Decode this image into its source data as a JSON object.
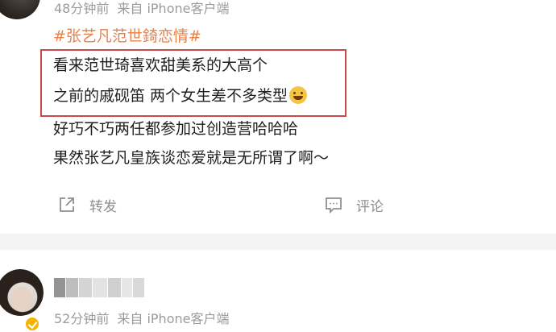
{
  "post1": {
    "time": "48分钟前",
    "source": "来自 iPhone客户端",
    "hashtag": "#张艺凡范世錡恋情#",
    "lines": [
      "看来范世琦喜欢甜美系的大高个",
      "之前的戚砚笛 两个女生差不多类型",
      "好巧不巧两任都参加过创造营哈哈哈",
      "果然张艺凡皇族谈恋爱就是无所谓了啊～"
    ],
    "emoji": "laughing-tears-emoji",
    "repost_label": "转发",
    "comment_label": "评论"
  },
  "post2": {
    "time": "52分钟前",
    "source": "来自 iPhone客户端"
  },
  "colors": {
    "hashtag": "#e8834a",
    "highlight_box": "#c94a4a",
    "meta_text": "#9b9b9b",
    "divider": "#f4f4f4"
  }
}
